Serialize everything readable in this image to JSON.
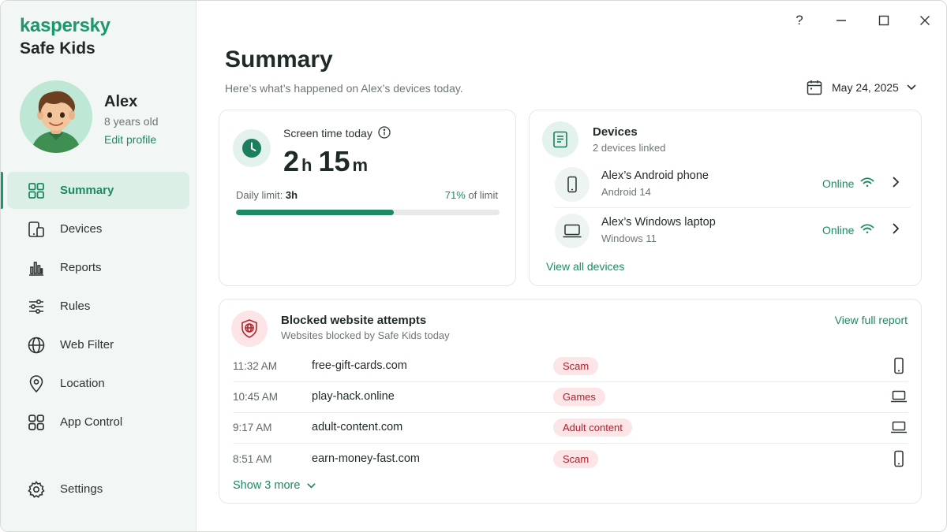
{
  "brand": {
    "logo": "kaspersky",
    "product": "Safe Kids"
  },
  "profile": {
    "name": "Alex",
    "age": "8 years old",
    "edit_label": "Edit profile"
  },
  "nav": {
    "items": [
      {
        "label": "Summary",
        "icon": "grid-icon",
        "active": true
      },
      {
        "label": "Devices",
        "icon": "devices-icon"
      },
      {
        "label": "Reports",
        "icon": "bar-chart-icon"
      },
      {
        "label": "Rules",
        "icon": "sliders-icon"
      },
      {
        "label": "Web Filter",
        "icon": "globe-icon"
      },
      {
        "label": "Location",
        "icon": "location-pin-icon"
      },
      {
        "label": "App Control",
        "icon": "apps-icon"
      }
    ],
    "settings_label": "Settings"
  },
  "window": {
    "help": "?"
  },
  "header": {
    "title": "Summary",
    "subtitle": "Here’s what’s happened on Alex’s devices today.",
    "date": "May 24, 2025"
  },
  "screen_time": {
    "label": "Screen time today",
    "hours": "2",
    "hours_unit": "h",
    "minutes": "15",
    "minutes_unit": "m",
    "limit_label": "Daily limit:",
    "limit_value": "3h",
    "percent_label": "71%",
    "percent_suffix": "of limit",
    "progress_fraction": 0.6
  },
  "devices": {
    "title": "Devices",
    "subtitle": "2 devices linked",
    "items": [
      {
        "name": "Alex’s Android phone",
        "os": "Android 14",
        "status": "Online",
        "icon": "phone-icon"
      },
      {
        "name": "Alex’s Windows laptop",
        "os": "Windows 11",
        "status": "Online",
        "icon": "laptop-icon"
      }
    ],
    "view_all": "View all devices"
  },
  "blocked": {
    "title": "Blocked website attempts",
    "subtitle": "Websites blocked by Safe Kids today",
    "report_link": "View full report",
    "rows": [
      {
        "time": "11:32 AM",
        "site": "free-gift-cards.com",
        "category": "Scam",
        "device": "phone-icon"
      },
      {
        "time": "10:45 AM",
        "site": "play-hack.online",
        "category": "Games",
        "device": "laptop-icon"
      },
      {
        "time": "9:17 AM",
        "site": "adult-content.com",
        "category": "Adult content",
        "device": "laptop-icon"
      },
      {
        "time": "8:51 AM",
        "site": "earn-money-fast.com",
        "category": "Scam",
        "device": "phone-icon"
      }
    ],
    "show_more": "Show 3 more"
  },
  "colors": {
    "accent": "#1b8a65",
    "brand": "#1b9870",
    "tag_bg": "#fde4e6",
    "tag_text": "#a8242e"
  }
}
